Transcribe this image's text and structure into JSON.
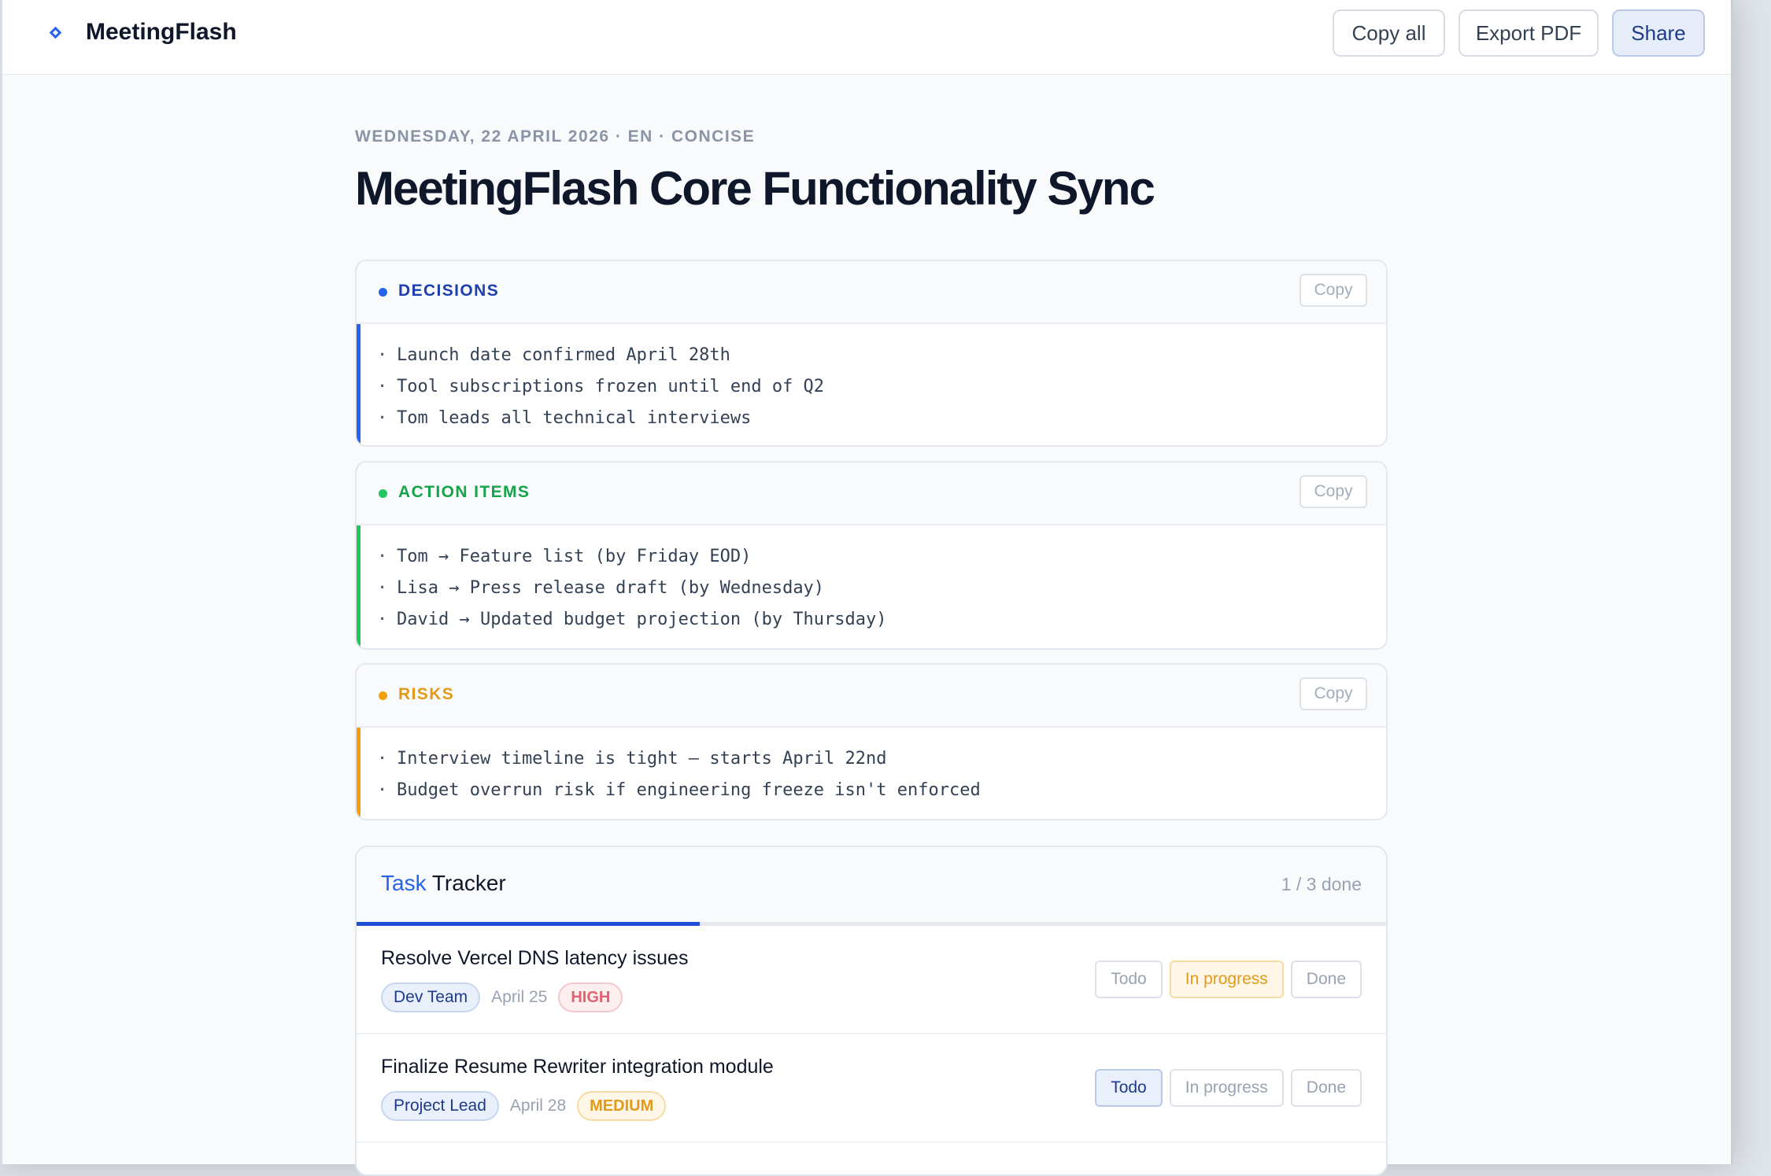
{
  "app": {
    "brand": "MeetingFlash"
  },
  "toolbar": {
    "copy_all": "Copy all",
    "export_pdf": "Export PDF",
    "share": "Share"
  },
  "meeting": {
    "dateline": "WEDNESDAY, 22 APRIL 2026 · EN · CONCISE",
    "title": "MeetingFlash Core Functionality Sync"
  },
  "sections": {
    "decisions": {
      "label": "DECISIONS",
      "copy": "Copy",
      "color": "#2563eb",
      "label_color": "#1e40af",
      "items": [
        "Launch date confirmed April 28th",
        "Tool subscriptions frozen until end of Q2",
        "Tom leads all technical interviews"
      ]
    },
    "actions": {
      "label": "ACTION ITEMS",
      "copy": "Copy",
      "color": "#22c55e",
      "label_color": "#16a34a",
      "items": [
        "Tom → Feature list (by Friday EOD)",
        "Lisa → Press release draft (by Wednesday)",
        "David → Updated budget projection (by Thursday)"
      ]
    },
    "risks": {
      "label": "RISKS",
      "copy": "Copy",
      "color": "#f59e0b",
      "label_color": "#e29a1b",
      "items": [
        "Interview timeline is tight — starts April 22nd",
        "Budget overrun risk if engineering freeze isn't enforced"
      ]
    }
  },
  "tracker": {
    "title_accent": "Task",
    "title_rest": "Tracker",
    "count": "1 / 3 done",
    "progress_fraction": 0.333,
    "status_labels": {
      "todo": "Todo",
      "in_progress": "In progress",
      "done": "Done"
    },
    "tasks": [
      {
        "name": "Resolve Vercel DNS latency issues",
        "owner": "Dev Team",
        "date": "April 25",
        "priority": "HIGH",
        "status": "in_progress"
      },
      {
        "name": "Finalize Resume Rewriter integration module",
        "owner": "Project Lead",
        "date": "April 28",
        "priority": "MEDIUM",
        "status": "todo"
      }
    ]
  }
}
